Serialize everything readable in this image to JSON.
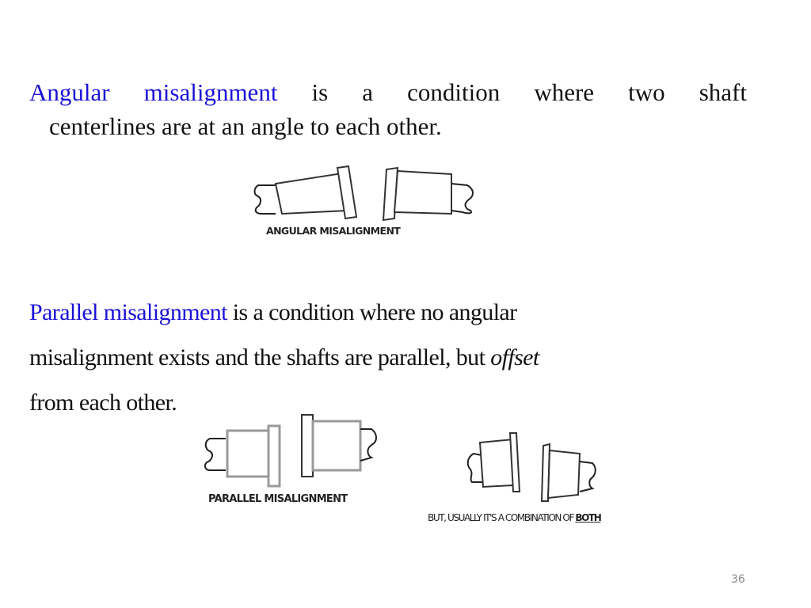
{
  "slide": {
    "paragraph1": {
      "term": "Angular misalignment",
      "line1_words": [
        "Angular",
        "misalignment",
        "is",
        "a",
        "condition",
        "where",
        "two",
        "shaft"
      ],
      "line2": "centerlines are at an angle to each other."
    },
    "paragraph2": {
      "term": "Parallel misalignment",
      "line1_rest": " is a condition where no angular",
      "line2_pre": "misalignment exists and the shafts are parallel, but ",
      "line2_italic": "offset",
      "line3": "from each other."
    },
    "figures": {
      "angular": {
        "caption": "ANGULAR MISALIGNMENT"
      },
      "parallel": {
        "caption": "PARALLEL MISALIGNMENT"
      },
      "both": {
        "caption_pre": "BUT, USUALLY IT'S A COMBINATION OF ",
        "caption_underlined": "BOTH"
      }
    },
    "page_number": "36",
    "colors": {
      "highlight": "#1a12d6",
      "text": "#111111"
    }
  }
}
